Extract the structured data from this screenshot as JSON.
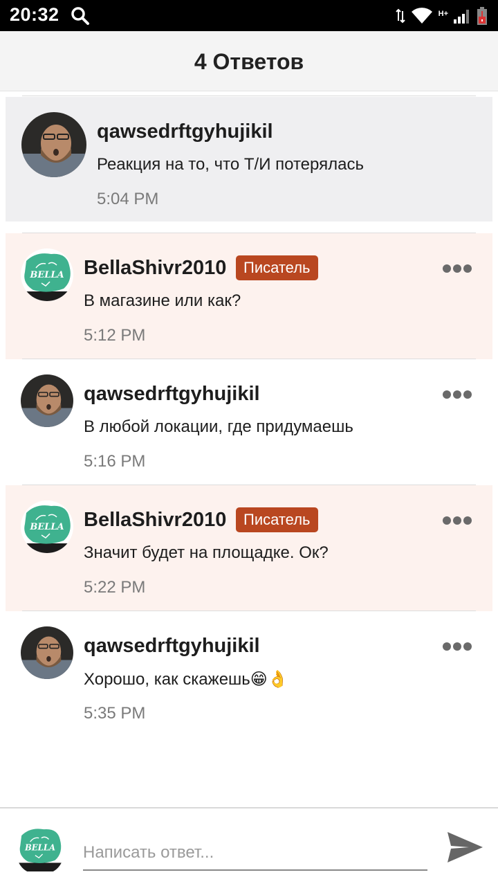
{
  "status_bar": {
    "time": "20:32",
    "network": "H+"
  },
  "header": {
    "title": "4 Ответов"
  },
  "original_comment": {
    "username": "qawsedrftgyhujikil",
    "text": "Реакция на то, что Т/И потерялась",
    "time": "5:04 PM"
  },
  "replies": [
    {
      "username": "BellaShivr2010",
      "badge": "Писатель",
      "text": "В магазине или как?",
      "time": "5:12 PM"
    },
    {
      "username": "qawsedrftgyhujikil",
      "text": "В любой локации, где придумаешь",
      "time": "5:16 PM"
    },
    {
      "username": "BellaShivr2010",
      "badge": "Писатель",
      "text": "Значит будет на площадке. Ок?",
      "time": "5:22 PM"
    },
    {
      "username": "qawsedrftgyhujikil",
      "text": "Хорошо, как скажешь😁👌",
      "time": "5:35 PM"
    }
  ],
  "composer": {
    "placeholder": "Написать ответ..."
  },
  "avatar_logo_text": "BELLA",
  "colors": {
    "author_bg": "#fdf2ee",
    "badge": "#b94720",
    "original_bg": "#efeff1"
  }
}
